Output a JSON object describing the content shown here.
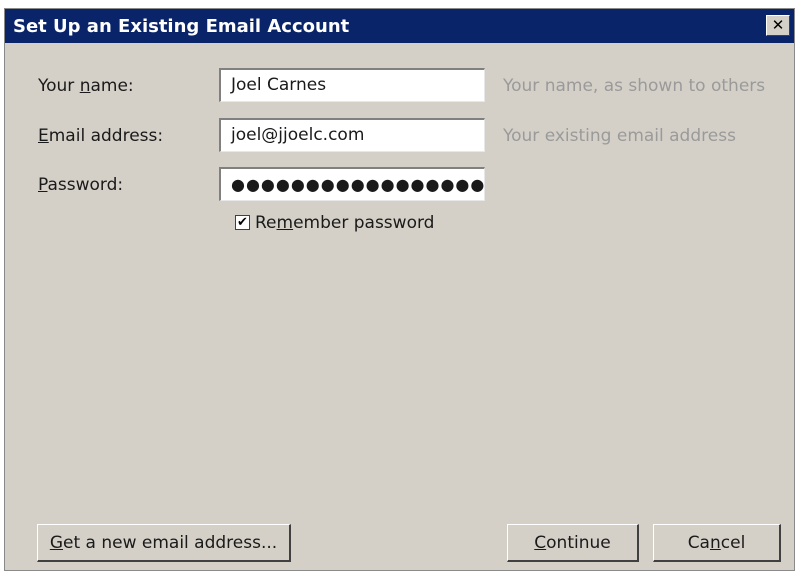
{
  "window": {
    "title": "Set Up an Existing Email Account",
    "close_glyph": "✕"
  },
  "form": {
    "name": {
      "label_prefix": "Your ",
      "label_key": "n",
      "label_rest": "ame:",
      "value": "Joel Carnes",
      "hint": "Your name, as shown to others"
    },
    "email": {
      "label_key": "E",
      "label_rest": "mail address:",
      "value": "joel@jjoelc.com",
      "hint": "Your existing email address"
    },
    "password": {
      "label_key": "P",
      "label_rest": "assword:",
      "value": "●●●●●●●●●●●●●●●●●●"
    },
    "remember": {
      "checked_glyph": "✔",
      "label_prefix": "Re",
      "label_key": "m",
      "label_rest": "ember password"
    }
  },
  "buttons": {
    "new_address": {
      "label_key": "G",
      "label_rest": "et a new email address..."
    },
    "continue": {
      "label_key": "C",
      "label_rest": "ontinue"
    },
    "cancel": {
      "label_prefix": "Ca",
      "label_key": "n",
      "label_rest": "cel"
    }
  }
}
